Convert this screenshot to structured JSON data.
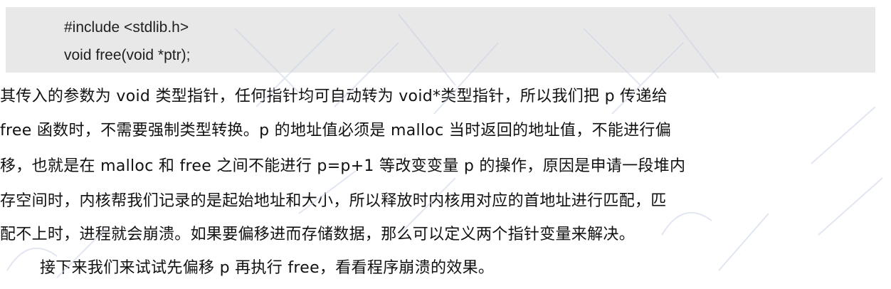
{
  "code": {
    "line1": "#include <stdlib.h>",
    "line2": "void free(void *ptr);"
  },
  "paragraph": {
    "line1": "其传入的参数为 void 类型指针，任何指针均可自动转为 void*类型指针，所以我们把 p 传递给",
    "line2": "free 函数时，不需要强制类型转换。p 的地址值必须是 malloc 当时返回的地址值，不能进行偏",
    "line3": "移，也就是在 malloc 和 free 之间不能进行 p=p+1 等改变变量 p 的操作，原因是申请一段堆内",
    "line4": "存空间时，内核帮我们记录的是起始地址和大小，所以释放时内核用对应的首地址进行匹配，匹",
    "line5": "配不上时，进程就会崩溃。如果要偏移进而存储数据，那么可以定义两个指针变量来解决。",
    "line6": "接下来我们来试试先偏移 p 再执行 free，看看程序崩溃的效果。"
  },
  "colors": {
    "code_background": "#e8e8e8",
    "text": "#111111",
    "watermark": "#c8d2e6"
  }
}
